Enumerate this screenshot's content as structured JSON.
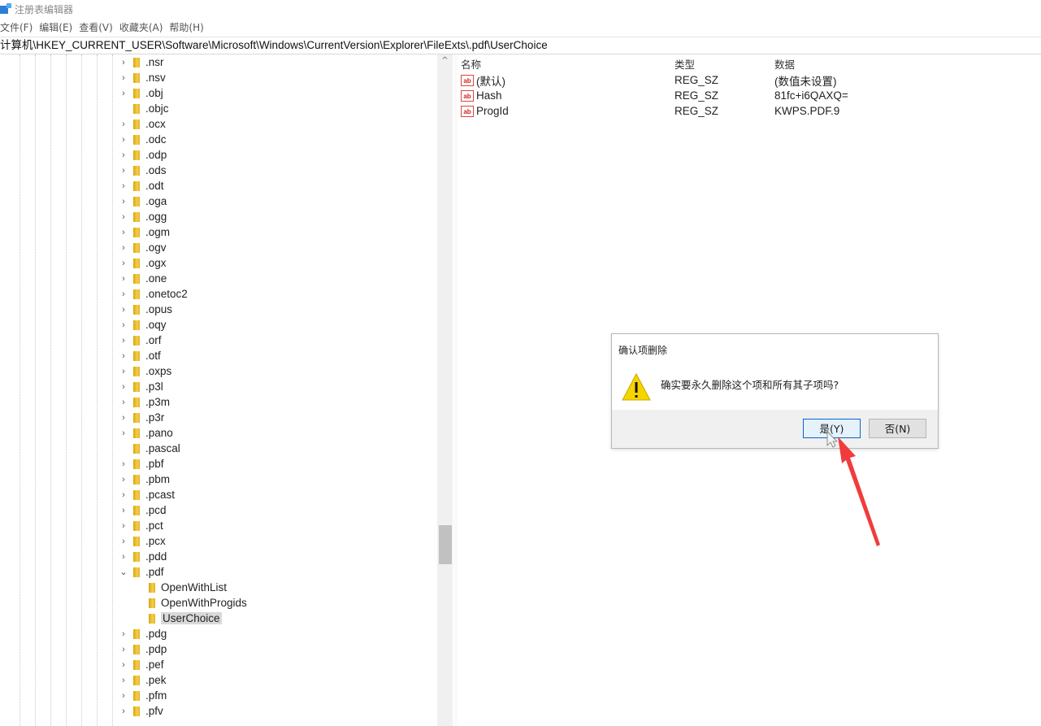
{
  "window": {
    "title": "注册表编辑器"
  },
  "menu": [
    "文件(F)",
    "编辑(E)",
    "查看(V)",
    "收藏夹(A)",
    "帮助(H)"
  ],
  "address": "计算机\\HKEY_CURRENT_USER\\Software\\Microsoft\\Windows\\CurrentVersion\\Explorer\\FileExts\\.pdf\\UserChoice",
  "tree_keys": [
    ".nsr",
    ".nsv",
    ".obj",
    ".objc",
    ".ocx",
    ".odc",
    ".odp",
    ".ods",
    ".odt",
    ".oga",
    ".ogg",
    ".ogm",
    ".ogv",
    ".ogx",
    ".one",
    ".onetoc2",
    ".opus",
    ".oqy",
    ".orf",
    ".otf",
    ".oxps",
    ".p3l",
    ".p3m",
    ".p3r",
    ".pano",
    ".pascal",
    ".pbf",
    ".pbm",
    ".pcast",
    ".pcd",
    ".pct",
    ".pcx",
    ".pdd",
    ".pdf",
    "OpenWithList",
    "OpenWithProgids",
    "UserChoice",
    ".pdg",
    ".pdp",
    ".pef",
    ".pek",
    ".pfm",
    ".pfv"
  ],
  "values_pane": {
    "headers": {
      "name": "名称",
      "type": "类型",
      "data": "数据"
    },
    "rows": [
      {
        "name": "(默认)",
        "type": "REG_SZ",
        "data": "(数值未设置)"
      },
      {
        "name": "Hash",
        "type": "REG_SZ",
        "data": "81fc+i6QAXQ="
      },
      {
        "name": "ProgId",
        "type": "REG_SZ",
        "data": "KWPS.PDF.9"
      }
    ]
  },
  "dialog": {
    "title": "确认项删除",
    "message": "确实要永久删除这个项和所有其子项吗?",
    "yes_label": "是(Y)",
    "no_label": "否(N)"
  },
  "colors": {
    "annotation_arrow": "#f03c3c",
    "folder": "#f4cf45",
    "selection": "#d9d9d9"
  }
}
